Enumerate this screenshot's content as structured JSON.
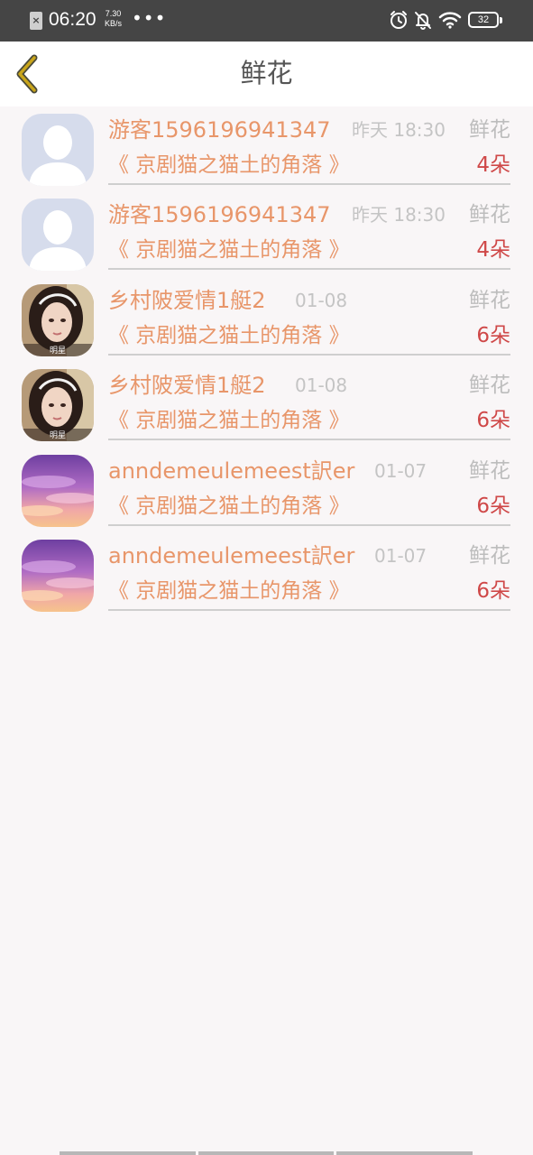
{
  "status_bar": {
    "time": "06:20",
    "speed_value": "7.30",
    "speed_unit": "KB/s",
    "battery": "32"
  },
  "header": {
    "title": "鲜花"
  },
  "rows": [
    {
      "user": "游客1596196941347",
      "time": "昨天 18:30",
      "gift_type": "鲜花",
      "book": "《 京剧猫之猫土的角落 》",
      "count": "4朵",
      "avatar": "default-person"
    },
    {
      "user": "游客1596196941347",
      "time": "昨天 18:30",
      "gift_type": "鲜花",
      "book": "《 京剧猫之猫土的角落 》",
      "count": "4朵",
      "avatar": "default-person"
    },
    {
      "user": "乡村陂爱情1艇2",
      "time": "01-08",
      "gift_type": "鲜花",
      "book": "《 京剧猫之猫土的角落 》",
      "count": "6朵",
      "avatar": "girl-photo",
      "avatar_caption": "明星"
    },
    {
      "user": "乡村陂爱情1艇2",
      "time": "01-08",
      "gift_type": "鲜花",
      "book": "《 京剧猫之猫土的角落 》",
      "count": "6朵",
      "avatar": "girl-photo",
      "avatar_caption": "明星"
    },
    {
      "user": "anndemeulemeest訳er",
      "time": "01-07",
      "gift_type": "鲜花",
      "book": "《 京剧猫之猫土的角落 》",
      "count": "6朵",
      "avatar": "sky-photo"
    },
    {
      "user": "anndemeulemeest訳er",
      "time": "01-07",
      "gift_type": "鲜花",
      "book": "《 京剧猫之猫土的角落 》",
      "count": "6朵",
      "avatar": "sky-photo"
    }
  ],
  "colors": {
    "accent": "#e8966a",
    "count": "#cf4848",
    "muted": "#c4c4c4",
    "back_arrow": "#c9a51a"
  }
}
